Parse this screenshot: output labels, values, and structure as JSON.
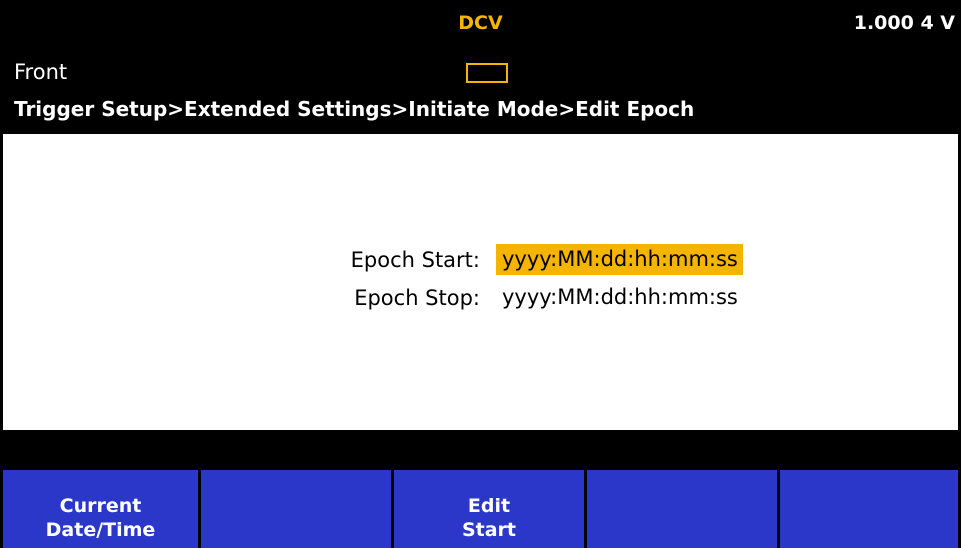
{
  "header": {
    "mode": "DCV",
    "reading": "1.000 4 V",
    "terminal": "Front",
    "breadcrumb": "Trigger Setup>Extended Settings>Initiate Mode>Edit Epoch"
  },
  "fields": [
    {
      "label": "Epoch Start:",
      "value": "yyyy:MM:dd:hh:mm:ss",
      "selected": true
    },
    {
      "label": "Epoch Stop:",
      "value": "yyyy:MM:dd:hh:mm:ss",
      "selected": false
    }
  ],
  "softkeys": [
    {
      "line1": "Current",
      "line2": "Date/Time"
    },
    {
      "line1": "",
      "line2": ""
    },
    {
      "line1": "Edit",
      "line2": "Start"
    },
    {
      "line1": "",
      "line2": ""
    },
    {
      "line1": "",
      "line2": ""
    }
  ],
  "colors": {
    "accent": "#f5b400",
    "softkey": "#2a37c9"
  }
}
